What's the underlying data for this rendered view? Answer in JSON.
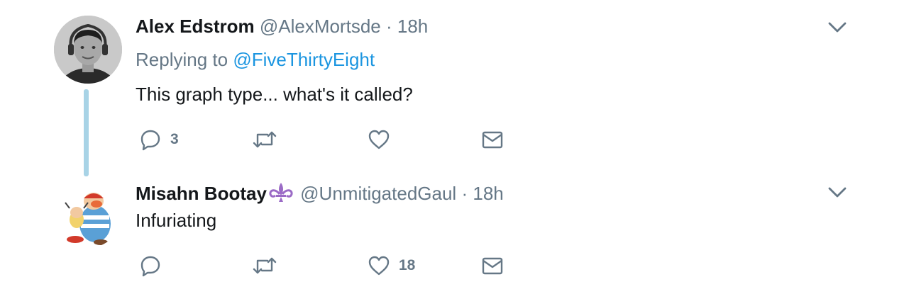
{
  "tweets": [
    {
      "name": "Alex Edstrom",
      "handle": "@AlexMortsde",
      "separator": "·",
      "time": "18h",
      "replying_label": "Replying to",
      "replying_mention": "@FiveThirtyEight",
      "text": "This graph type... what's it called?",
      "reply_count": "3",
      "retweet_count": "",
      "like_count": ""
    },
    {
      "name": "Misahn Bootay",
      "handle": "@UnmitigatedGaul",
      "separator": "·",
      "time": "18h",
      "text": "Infuriating",
      "reply_count": "",
      "retweet_count": "",
      "like_count": "18"
    }
  ],
  "icons": {
    "reply": "reply-icon",
    "retweet": "retweet-icon",
    "like": "heart-icon",
    "dm": "envelope-icon",
    "menu": "chevron-down-icon",
    "name_emoji": "fleur-de-lis-icon"
  },
  "colors": {
    "name": "#14171a",
    "meta": "#657786",
    "mention": "#1b95e0",
    "thread_line": "#a8d3e6",
    "fleur": "#9b6bc6"
  }
}
